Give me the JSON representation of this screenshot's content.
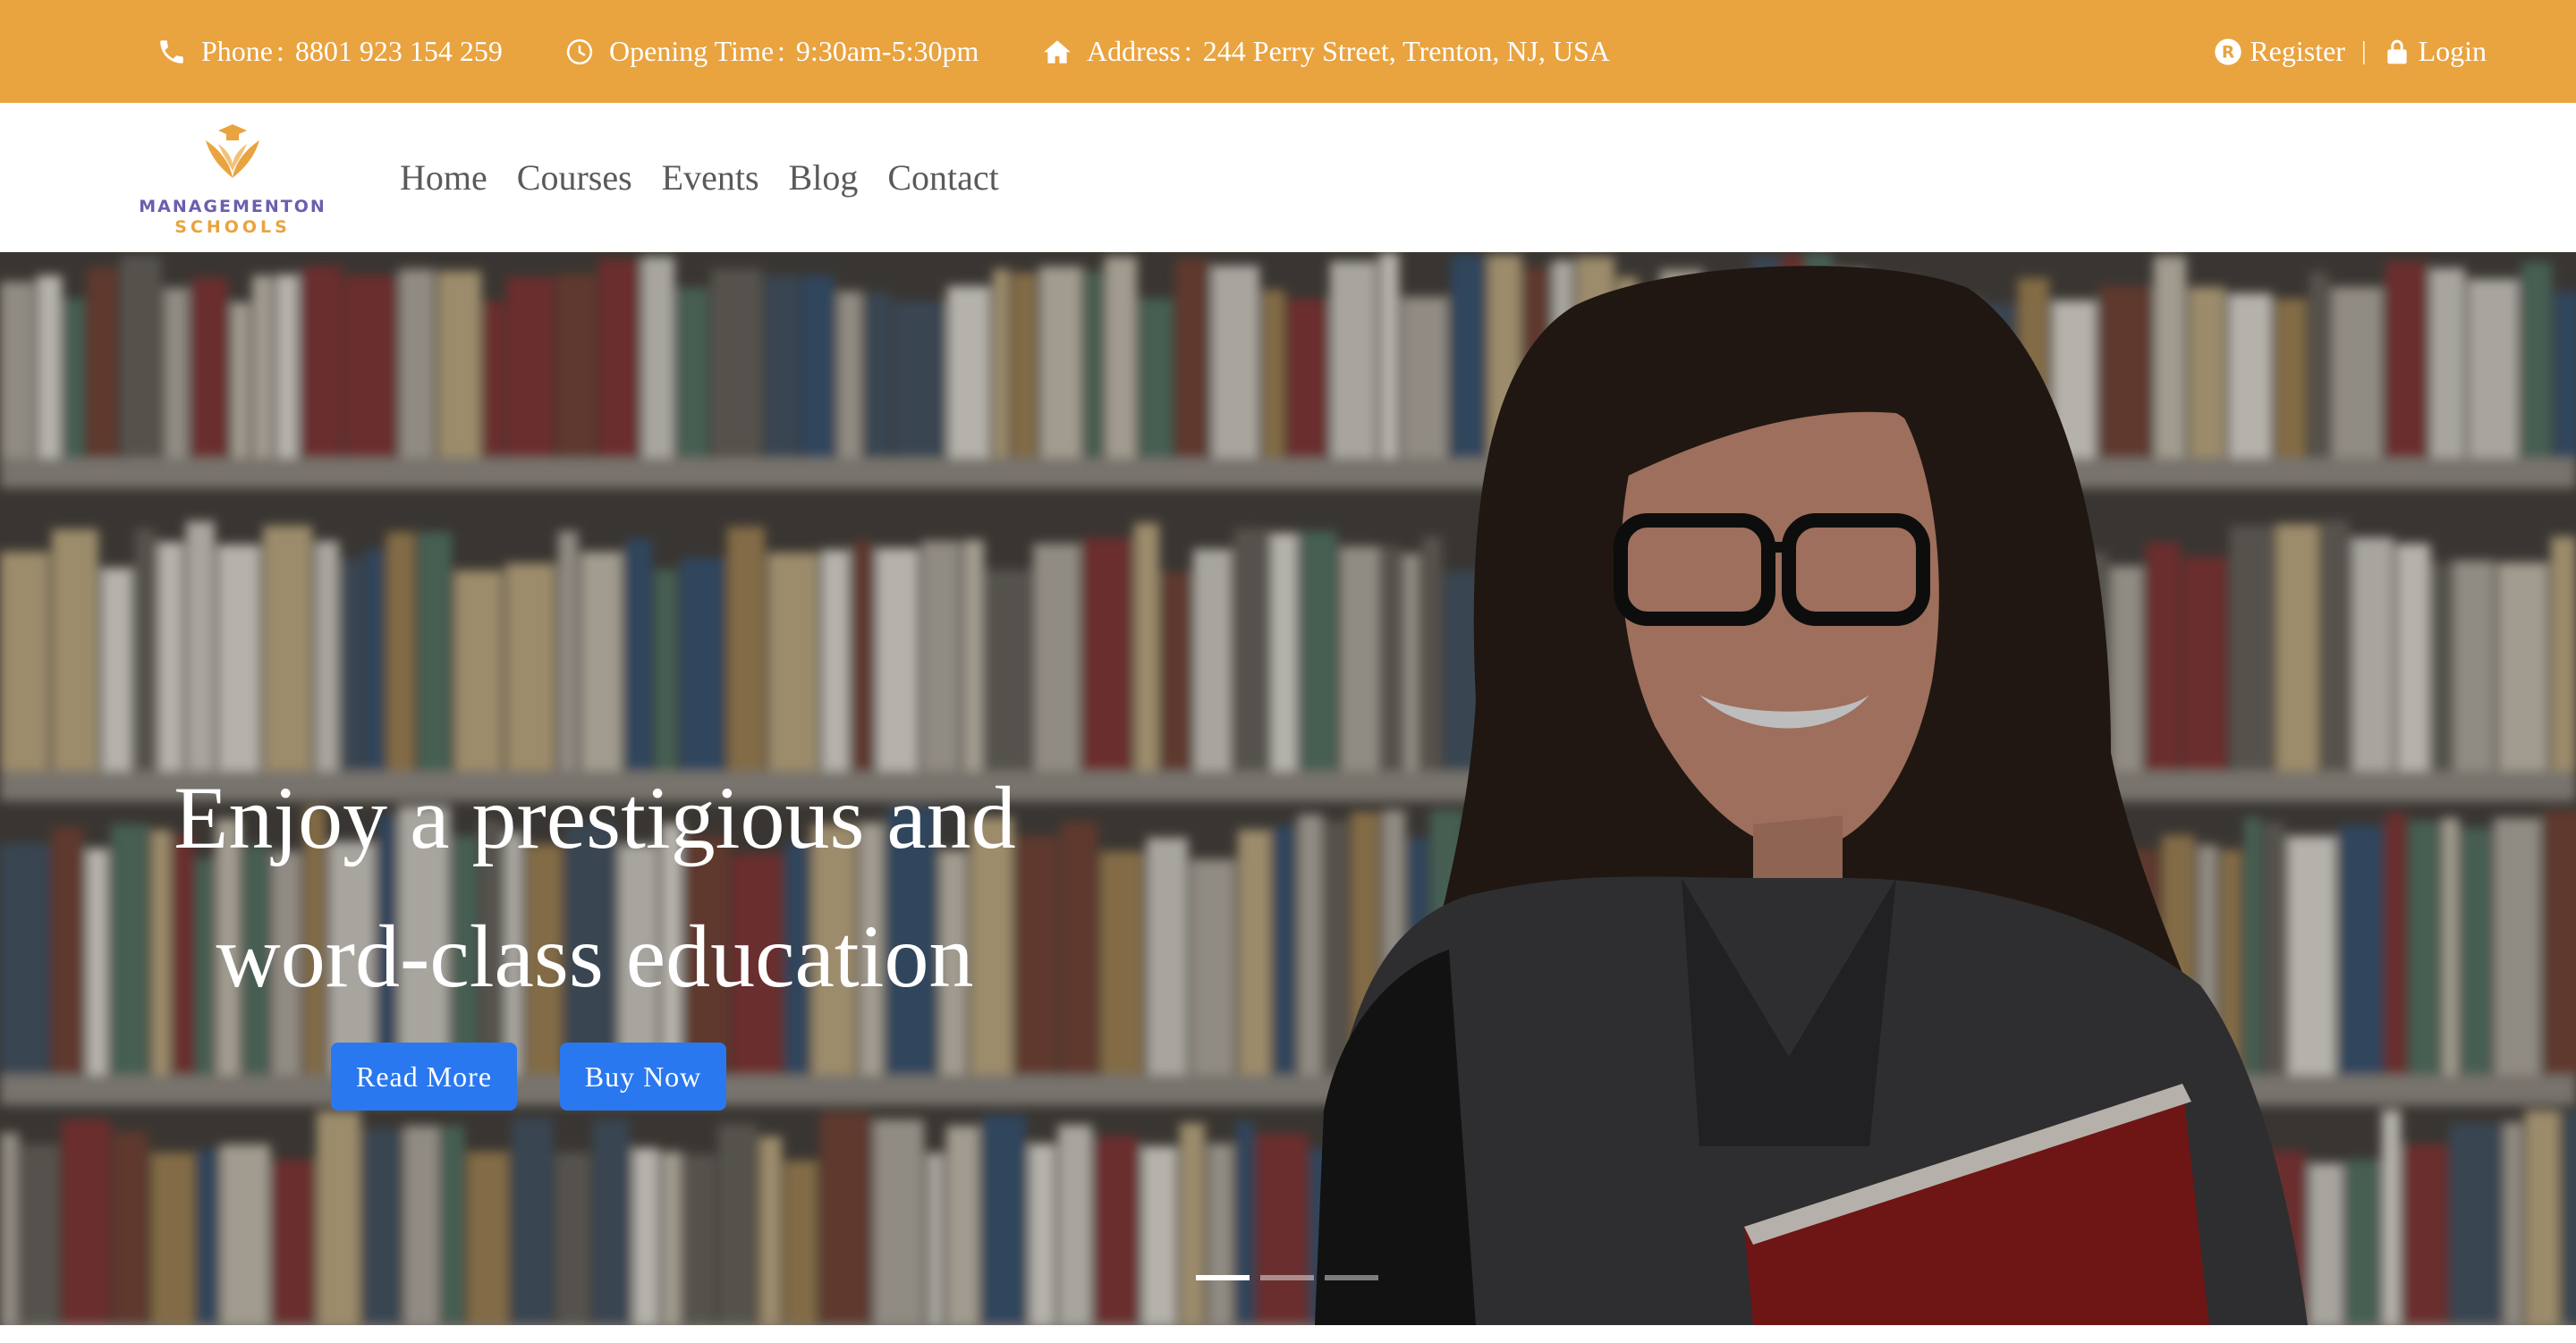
{
  "topbar": {
    "phone_label": "Phone",
    "phone_value": "8801 923 154 259",
    "hours_label": "Opening Time",
    "hours_value": "9:30am-5:30pm",
    "address_label": "Address",
    "address_value": "244 Perry Street, Trenton, NJ, USA",
    "separator": ":",
    "register": "Register",
    "divider": "|",
    "login": "Login",
    "icons": [
      "phone-icon",
      "clock-icon",
      "home-icon",
      "registered-icon",
      "lock-icon"
    ]
  },
  "logo": {
    "line1": "MANAGEMENTON",
    "line2": "SCHOOLS"
  },
  "nav": {
    "items": [
      "Home",
      "Courses",
      "Events",
      "Blog",
      "Contact"
    ]
  },
  "hero": {
    "title_line1": "Enjoy a prestigious and",
    "title_line2": "word-class education",
    "read_more": "Read More",
    "buy_now": "Buy Now",
    "slides_total": 3,
    "active_slide": 1
  },
  "colors": {
    "topbar_bg": "#e9a33f",
    "button_bg": "#2a78f0",
    "logo_purple": "#6a5fb0",
    "nav_text": "#5a5a5a"
  }
}
